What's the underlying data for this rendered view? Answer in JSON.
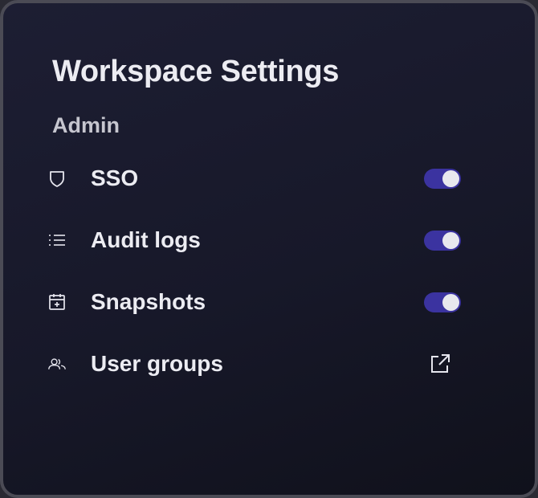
{
  "header": {
    "title": "Workspace Settings"
  },
  "section": {
    "label": "Admin"
  },
  "items": [
    {
      "label": "SSO",
      "icon": "shield-icon",
      "control": "toggle",
      "enabled": true
    },
    {
      "label": "Audit logs",
      "icon": "list-icon",
      "control": "toggle",
      "enabled": true
    },
    {
      "label": "Snapshots",
      "icon": "calendar-plus-icon",
      "control": "toggle",
      "enabled": true
    },
    {
      "label": "User groups",
      "icon": "users-icon",
      "control": "external-link"
    }
  ],
  "colors": {
    "accent": "#3b33a0",
    "background": "#1b1c2e",
    "text": "#ececf2"
  }
}
